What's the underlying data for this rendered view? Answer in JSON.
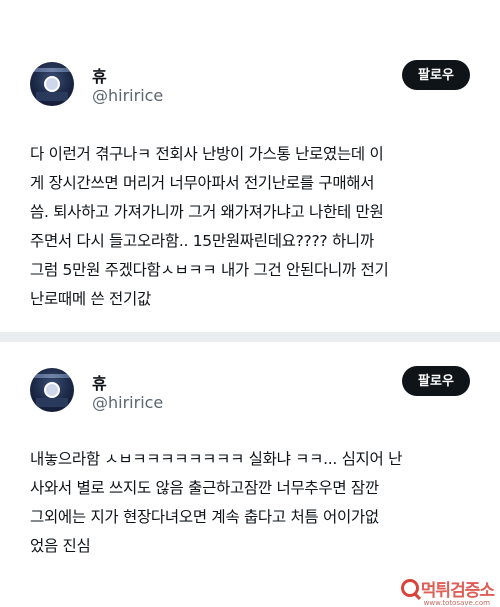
{
  "tweets": [
    {
      "author": {
        "name": "휴",
        "handle": "@hiririce"
      },
      "follow_label": "팔로우",
      "lines": [
        "다 이런거 겪구나ㅋ 전회사 난방이 가스통 난로였는데 이",
        "게 장시간쓰면 머리거 너무아파서 전기난로를 구매해서",
        "씀. 퇴사하고 가져가니까 그거 왜가져가냐고 나한테 만원",
        "주면서 다시 들고오라함.. 15만원짜린데요???? 하니까",
        "그럼 5만원 주겠다함ㅅㅂㅋㅋ 내가 그건 안된다니까 전기",
        "난로때메 쓴 전기값"
      ]
    },
    {
      "author": {
        "name": "휴",
        "handle": "@hiririce"
      },
      "follow_label": "팔로우",
      "lines": [
        "내놓으라함 ㅅㅂㅋㅋㅋㅋㅋㅋㅋㅋ 실화냐 ㅋㅋ... 심지어 난",
        "사와서 별로 쓰지도 않음 출근하고잠깐 너무추우면 잠깐",
        "그외에는 지가 현장다녀오면 계속 춥다고 처틈 어이가없",
        "었음 진심"
      ]
    }
  ],
  "watermark": {
    "text": "먹튀검증소",
    "url": "www.totosave.com",
    "color": "#d9443a"
  },
  "colors": {
    "text": "#0f1419",
    "handle": "#5b6670",
    "button_bg": "#0f1419",
    "button_text": "#ffffff",
    "divider": "#e9edf0"
  }
}
